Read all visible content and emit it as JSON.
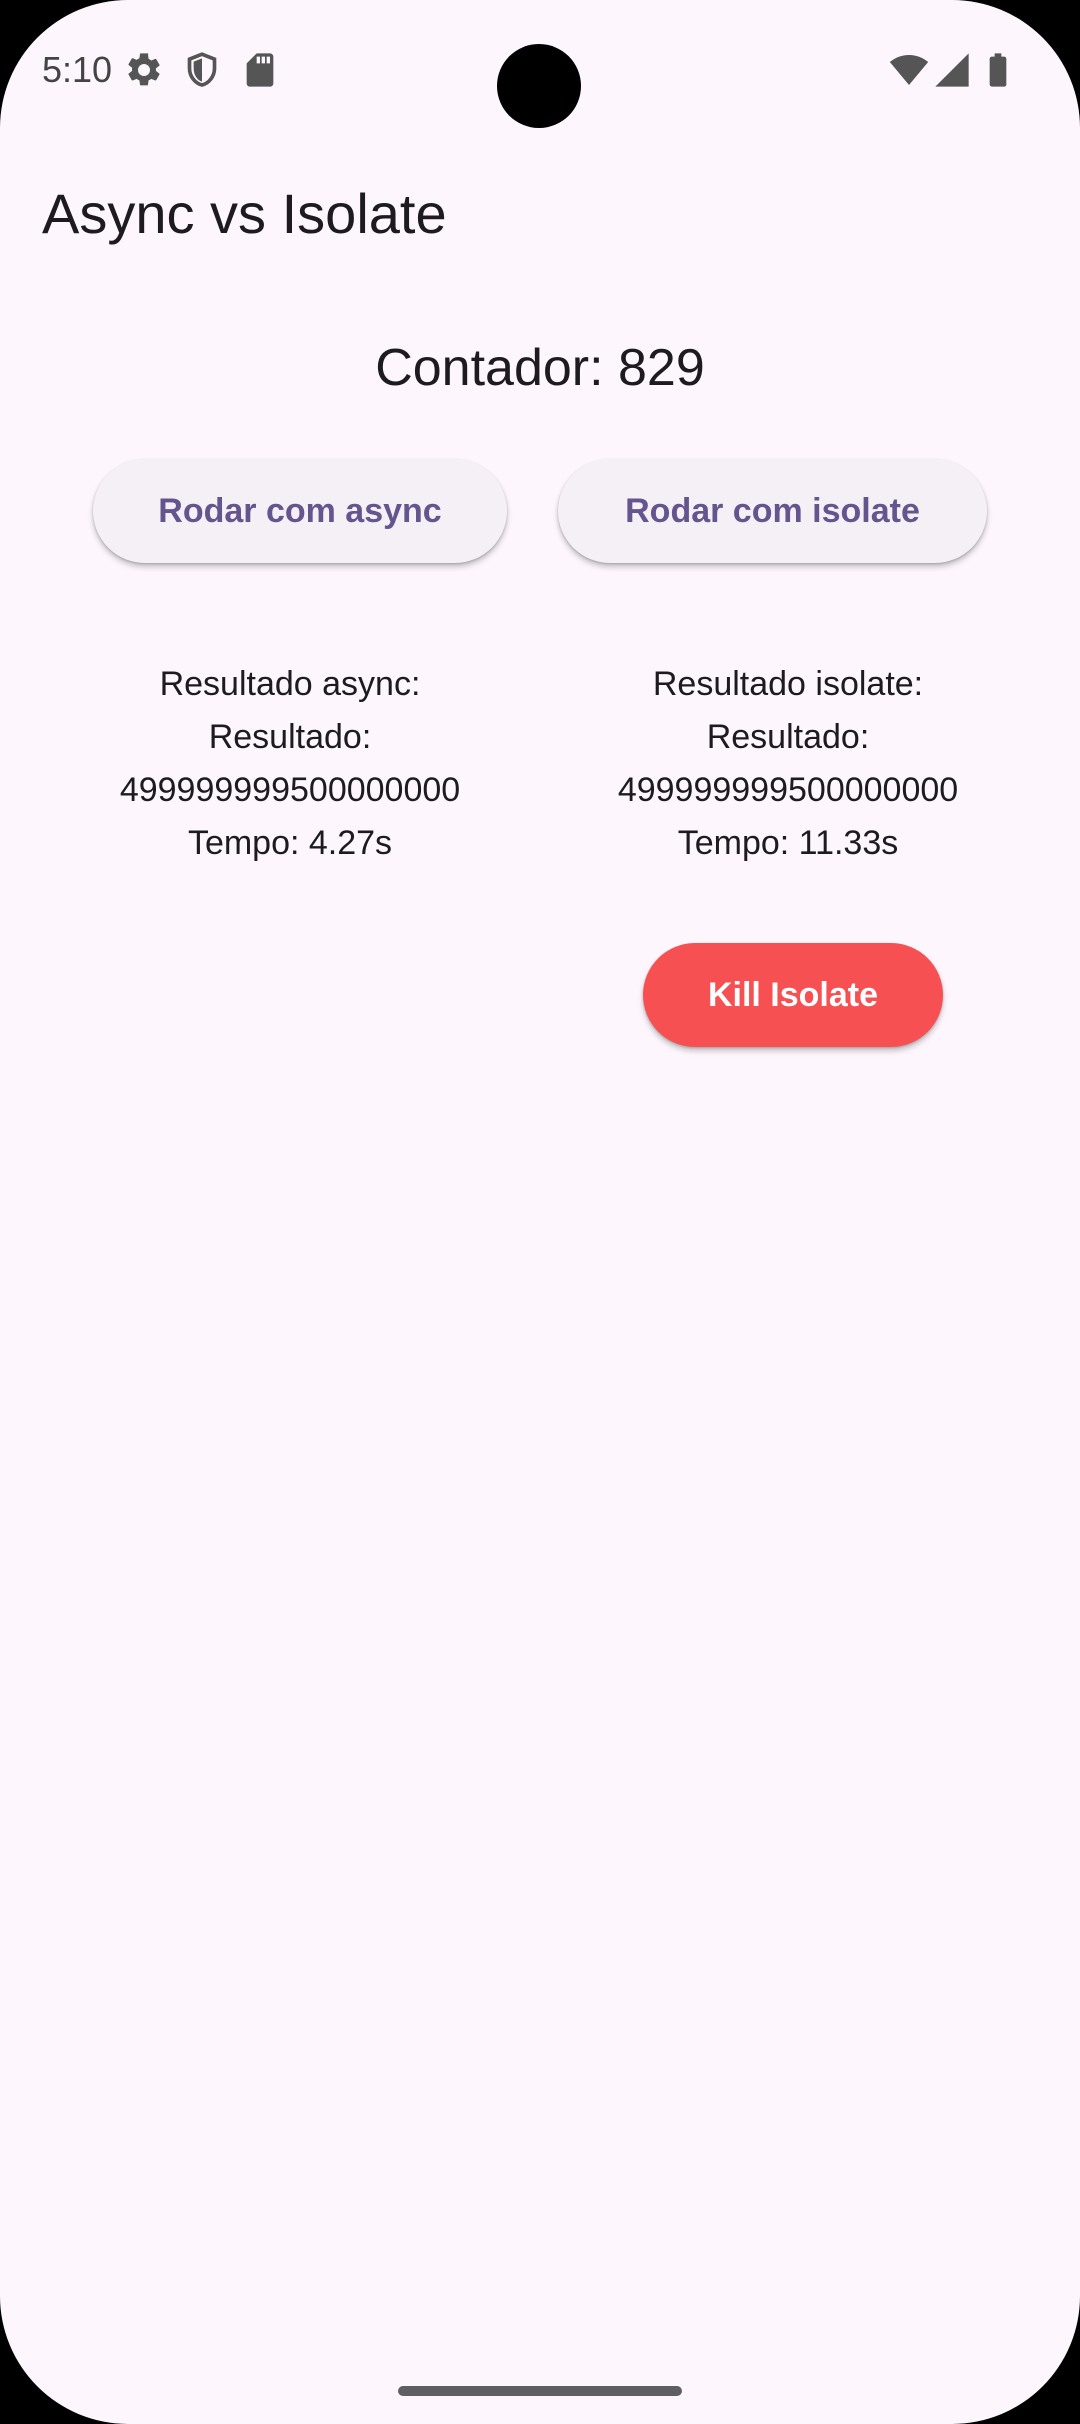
{
  "status_bar": {
    "time": "5:10",
    "icons": [
      "settings-icon",
      "shield-icon",
      "sd-card-icon",
      "wifi-icon",
      "cell-signal-icon",
      "battery-icon"
    ]
  },
  "app_bar": {
    "title": "Async vs Isolate"
  },
  "main": {
    "counter": "Contador: 829",
    "buttons": {
      "async": "Rodar com async",
      "isolate": "Rodar com isolate",
      "kill": "Kill Isolate"
    },
    "results": {
      "async": {
        "heading": "Resultado async:",
        "label": "Resultado:",
        "value": "499999999500000000",
        "time": "Tempo: 4.27s"
      },
      "isolate": {
        "heading": "Resultado isolate:",
        "label": "Resultado:",
        "value": "499999999500000000",
        "time": "Tempo: 11.33s"
      }
    }
  },
  "colors": {
    "background": "#fdf7fd",
    "button_text": "#65558f",
    "button_bg": "#f5f0f6",
    "kill_button_bg": "#f75052"
  }
}
